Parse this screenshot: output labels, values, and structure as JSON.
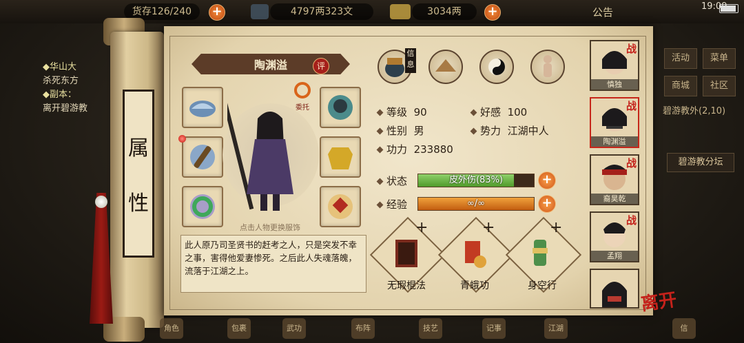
{
  "topbar": {
    "bag_count": "货存126/240",
    "silver": "4797两323文",
    "gold": "3034两",
    "announce": "公告",
    "time": "19:09"
  },
  "quest": {
    "line1": "◆华山大",
    "line2": "杀死东方",
    "line3": "◆副本：",
    "line4": "离开碧游教"
  },
  "scroll_tag": {
    "char1": "属",
    "char2": "性"
  },
  "character": {
    "name": "陶渊溢",
    "eval_badge": "评",
    "entrust": "委托",
    "change_hint": "点击人物更换服饰",
    "description": "此人原乃司圣贤书的赶考之人，只是突发不幸之事，害得他爱妻惨死。之后此人失魂落魄，流落于江湖之上。"
  },
  "tabs": {
    "info_label": "信息"
  },
  "stats": {
    "level_label": "等级",
    "level": "90",
    "favor_label": "好感",
    "favor": "100",
    "gender_label": "性别",
    "gender": "男",
    "faction_label": "势力",
    "faction": "江湖中人",
    "power_label": "功力",
    "power": "233880",
    "status_label": "状态",
    "status_text": "皮外伤(83%)",
    "status_fill": 0.83,
    "exp_label": "经验",
    "exp_text": "∞/∞",
    "exp_fill": 1.0
  },
  "skills": [
    {
      "name": "无瑕棍法"
    },
    {
      "name": "青蛾功"
    },
    {
      "name": "身空行"
    }
  ],
  "party": [
    {
      "name": "慎独",
      "tag": "战"
    },
    {
      "name": "陶渊溢",
      "tag": "战"
    },
    {
      "name": "裔昊乾",
      "tag": "战"
    },
    {
      "name": "孟翔",
      "tag": "战"
    },
    {
      "name": "",
      "tag": ""
    }
  ],
  "leave_label": "离开",
  "right_menu": {
    "activity": "活动",
    "menu": "菜单",
    "shop": "商城",
    "community": "社区",
    "location": "碧游教外(2,10)",
    "location_sub": "碧游教分坛"
  },
  "bottom_menu": [
    "角色",
    "包裹",
    "武功",
    "布阵",
    "技艺",
    "记事",
    "江湖",
    "信"
  ],
  "colors": {
    "accent_red": "#c4221b",
    "status_green": "#4f9a2a",
    "exp_orange": "#c25d10"
  }
}
